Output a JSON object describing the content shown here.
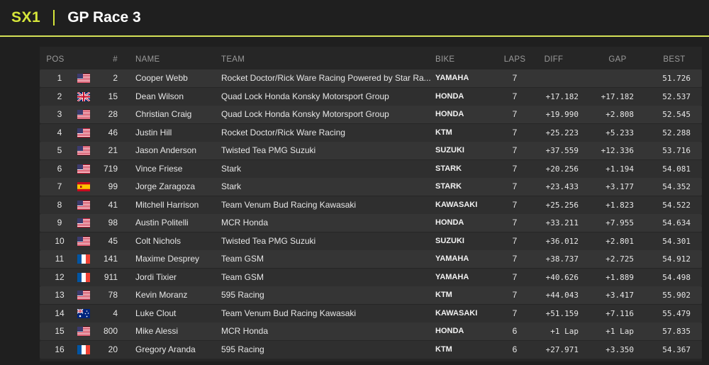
{
  "header": {
    "series": "SX1",
    "title": "GP Race 3"
  },
  "table": {
    "columns": {
      "pos": "POS",
      "num": "#",
      "name": "NAME",
      "team": "TEAM",
      "bike": "BIKE",
      "laps": "LAPS",
      "diff": "DIFF",
      "gap": "GAP",
      "best": "BEST"
    },
    "rows": [
      {
        "pos": "1",
        "flag": "us-flag-icon",
        "num": "2",
        "name": "Cooper Webb",
        "team": "Rocket Doctor/Rick Ware Racing Powered by Star Ra...",
        "bike": "YAMAHA",
        "laps": "7",
        "diff": "",
        "gap": "",
        "best": "51.726"
      },
      {
        "pos": "2",
        "flag": "uk-flag-icon",
        "num": "15",
        "name": "Dean Wilson",
        "team": "Quad Lock Honda Konsky Motorsport Group",
        "bike": "HONDA",
        "laps": "7",
        "diff": "+17.182",
        "gap": "+17.182",
        "best": "52.537"
      },
      {
        "pos": "3",
        "flag": "us-flag-icon",
        "num": "28",
        "name": "Christian Craig",
        "team": "Quad Lock Honda Konsky Motorsport Group",
        "bike": "HONDA",
        "laps": "7",
        "diff": "+19.990",
        "gap": "+2.808",
        "best": "52.545"
      },
      {
        "pos": "4",
        "flag": "us-flag-icon",
        "num": "46",
        "name": "Justin Hill",
        "team": "Rocket Doctor/Rick Ware Racing",
        "bike": "KTM",
        "laps": "7",
        "diff": "+25.223",
        "gap": "+5.233",
        "best": "52.288"
      },
      {
        "pos": "5",
        "flag": "us-flag-icon",
        "num": "21",
        "name": "Jason Anderson",
        "team": "Twisted Tea PMG Suzuki",
        "bike": "SUZUKI",
        "laps": "7",
        "diff": "+37.559",
        "gap": "+12.336",
        "best": "53.716"
      },
      {
        "pos": "6",
        "flag": "us-flag-icon",
        "num": "719",
        "name": "Vince Friese",
        "team": "Stark",
        "bike": "STARK",
        "laps": "7",
        "diff": "+20.256",
        "gap": "+1.194",
        "best": "54.081"
      },
      {
        "pos": "7",
        "flag": "es-flag-icon",
        "num": "99",
        "name": "Jorge Zaragoza",
        "team": "Stark",
        "bike": "STARK",
        "laps": "7",
        "diff": "+23.433",
        "gap": "+3.177",
        "best": "54.352"
      },
      {
        "pos": "8",
        "flag": "us-flag-icon",
        "num": "41",
        "name": "Mitchell Harrison",
        "team": "Team Venum Bud Racing Kawasaki",
        "bike": "KAWASAKI",
        "laps": "7",
        "diff": "+25.256",
        "gap": "+1.823",
        "best": "54.522"
      },
      {
        "pos": "9",
        "flag": "us-flag-icon",
        "num": "98",
        "name": "Austin Politelli",
        "team": "MCR Honda",
        "bike": "HONDA",
        "laps": "7",
        "diff": "+33.211",
        "gap": "+7.955",
        "best": "54.634"
      },
      {
        "pos": "10",
        "flag": "us-flag-icon",
        "num": "45",
        "name": "Colt Nichols",
        "team": "Twisted Tea PMG Suzuki",
        "bike": "SUZUKI",
        "laps": "7",
        "diff": "+36.012",
        "gap": "+2.801",
        "best": "54.301"
      },
      {
        "pos": "11",
        "flag": "fr-flag-icon",
        "num": "141",
        "name": "Maxime Desprey",
        "team": "Team GSM",
        "bike": "YAMAHA",
        "laps": "7",
        "diff": "+38.737",
        "gap": "+2.725",
        "best": "54.912"
      },
      {
        "pos": "12",
        "flag": "fr-flag-icon",
        "num": "911",
        "name": "Jordi Tixier",
        "team": "Team GSM",
        "bike": "YAMAHA",
        "laps": "7",
        "diff": "+40.626",
        "gap": "+1.889",
        "best": "54.498"
      },
      {
        "pos": "13",
        "flag": "us-flag-icon",
        "num": "78",
        "name": "Kevin Moranz",
        "team": "595 Racing",
        "bike": "KTM",
        "laps": "7",
        "diff": "+44.043",
        "gap": "+3.417",
        "best": "55.902"
      },
      {
        "pos": "14",
        "flag": "au-flag-icon",
        "num": "4",
        "name": "Luke Clout",
        "team": "Team Venum Bud Racing Kawasaki",
        "bike": "KAWASAKI",
        "laps": "7",
        "diff": "+51.159",
        "gap": "+7.116",
        "best": "55.479"
      },
      {
        "pos": "15",
        "flag": "us-flag-icon",
        "num": "800",
        "name": "Mike Alessi",
        "team": "MCR Honda",
        "bike": "HONDA",
        "laps": "6",
        "diff": "+1 Lap",
        "gap": "+1 Lap",
        "best": "57.835"
      },
      {
        "pos": "16",
        "flag": "fr-flag-icon",
        "num": "20",
        "name": "Gregory Aranda",
        "team": "595 Racing",
        "bike": "KTM",
        "laps": "6",
        "diff": "+27.971",
        "gap": "+3.350",
        "best": "54.367"
      }
    ]
  },
  "colors": {
    "accent": "#d6e63a",
    "background": "#1f1f1f",
    "row_odd": "#353535",
    "row_even": "#2f2f2f"
  }
}
